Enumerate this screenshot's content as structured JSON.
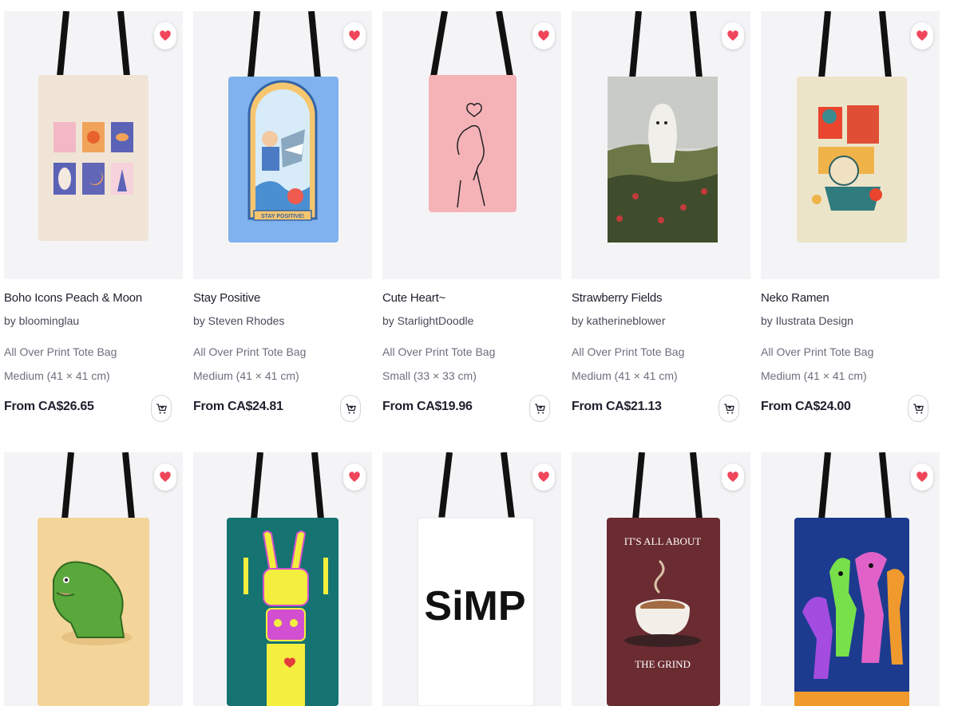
{
  "products": [
    {
      "title": "Boho Icons Peach & Moon",
      "artist": "by bloominglau",
      "type": "All Over Print Tote Bag",
      "size": "Medium (41 × 41 cm)",
      "price": "From CA$26.65"
    },
    {
      "title": "Stay Positive",
      "artist": "by Steven Rhodes",
      "type": "All Over Print Tote Bag",
      "size": "Medium (41 × 41 cm)",
      "price": "From CA$24.81",
      "design_text": "STAY POSITIVE!"
    },
    {
      "title": "Cute Heart~",
      "artist": "by StarlightDoodle",
      "type": "All Over Print Tote Bag",
      "size": "Small (33 × 33 cm)",
      "price": "From CA$19.96"
    },
    {
      "title": "Strawberry Fields",
      "artist": "by katherineblower",
      "type": "All Over Print Tote Bag",
      "size": "Medium (41 × 41 cm)",
      "price": "From CA$21.13"
    },
    {
      "title": "Neko Ramen",
      "artist": "by Ilustrata Design",
      "type": "All Over Print Tote Bag",
      "size": "Medium (41 × 41 cm)",
      "price": "From CA$24.00"
    },
    {
      "title": "",
      "artist": "",
      "type": "",
      "size": "",
      "price": ""
    },
    {
      "title": "",
      "artist": "",
      "type": "",
      "size": "",
      "price": ""
    },
    {
      "title": "",
      "artist": "",
      "type": "",
      "size": "",
      "price": "",
      "design_text": "SiMP"
    },
    {
      "title": "",
      "artist": "",
      "type": "",
      "size": "",
      "price": "",
      "design_text_top": "IT'S ALL ABOUT",
      "design_text_bottom": "THE GRIND"
    },
    {
      "title": "",
      "artist": "",
      "type": "",
      "size": "",
      "price": ""
    }
  ],
  "icons": {
    "favorite": "heart-icon",
    "cart": "add-to-cart-icon"
  },
  "colors": {
    "heart": "#f0455a",
    "strap": "#111111"
  }
}
